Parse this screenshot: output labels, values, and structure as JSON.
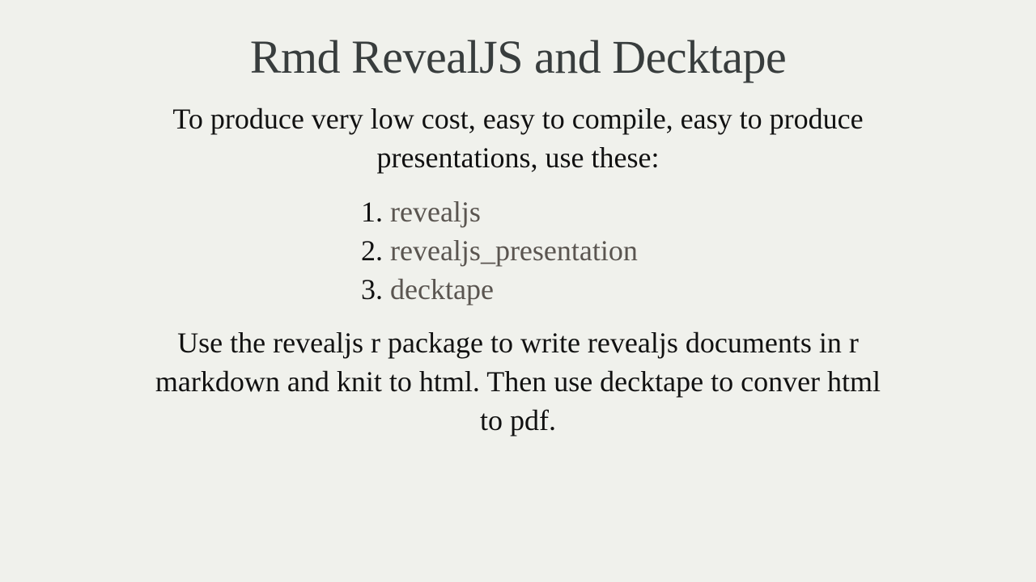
{
  "slide": {
    "title": "Rmd RevealJS and Decktape",
    "intro": "To produce very low cost, easy to compile, easy to produce presentations, use these:",
    "list": [
      {
        "number": "1.",
        "label": "revealjs"
      },
      {
        "number": "2.",
        "label": "revealjs_presentation"
      },
      {
        "number": "3.",
        "label": "decktape"
      }
    ],
    "outro": "Use the revealjs r package to write revealjs documents in r markdown and knit to html. Then use decktape to conver html to pdf."
  },
  "colors": {
    "background": "#f0f1ec",
    "title": "#383d3d",
    "text": "#111111",
    "link": "#5a5550"
  }
}
